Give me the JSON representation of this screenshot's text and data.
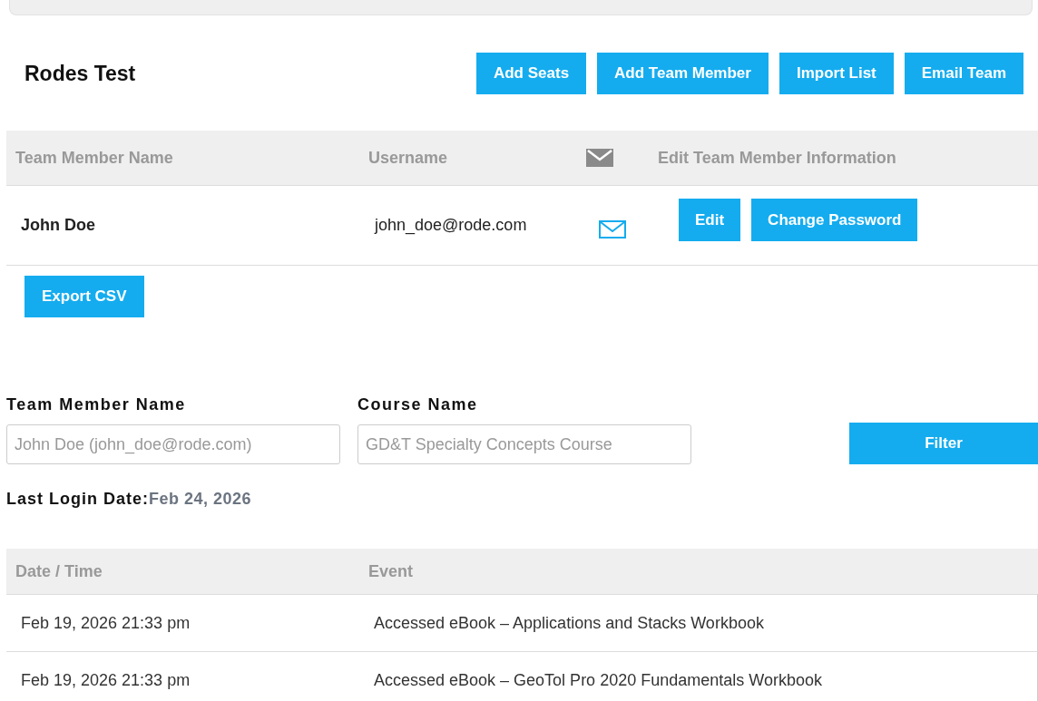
{
  "team": {
    "title": "Rodes Test",
    "actions": [
      "Add Seats",
      "Add Team Member",
      "Import List",
      "Email Team"
    ]
  },
  "members_table": {
    "columns": [
      "Team Member Name",
      "Username",
      "Edit Team Member Information"
    ],
    "rows": [
      {
        "name": "John Doe",
        "username": "john_doe@rode.com",
        "buttons": [
          "Edit",
          "Change Password"
        ]
      }
    ]
  },
  "export_button": "Export CSV",
  "filters": [
    {
      "label": "Team Member Name",
      "placeholder": "John Doe (john_doe@rode.com)"
    },
    {
      "label": "Course Name",
      "placeholder": "GD&T Specialty Concepts Course"
    }
  ],
  "filter_button": "Filter",
  "last_login": {
    "label": "Last Login Date:",
    "value": "Feb 24, 2026"
  },
  "log_table": {
    "columns": [
      "Date / Time",
      "Event"
    ],
    "rows": [
      {
        "date": "Feb 19, 2026 21:33 pm",
        "event": "Accessed eBook – Applications and Stacks Workbook"
      },
      {
        "date": "Feb 19, 2026 21:33 pm",
        "event": "Accessed eBook – GeoTol Pro 2020 Fundamentals Workbook"
      }
    ]
  }
}
